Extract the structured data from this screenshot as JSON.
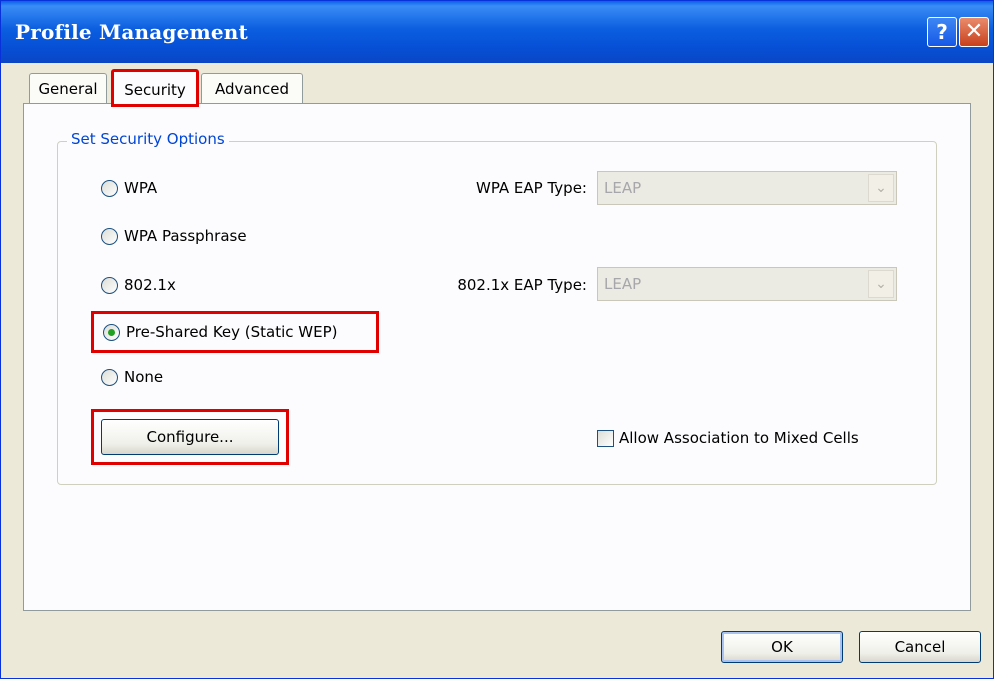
{
  "window": {
    "title": "Profile Management",
    "help_label": "?",
    "close_label": "✕"
  },
  "tabs": {
    "general": "General",
    "security": "Security",
    "advanced": "Advanced"
  },
  "security": {
    "group_label": "Set Security Options",
    "options": {
      "wpa": "WPA",
      "wpa_passphrase": "WPA Passphrase",
      "dot1x": "802.1x",
      "psk": "Pre-Shared Key (Static WEP)",
      "none": "None"
    },
    "selected_option": "Pre-Shared Key (Static WEP)",
    "wpa_eap_label": "WPA EAP Type:",
    "wpa_eap_value": "LEAP",
    "dot1x_eap_label": "802.1x EAP Type:",
    "dot1x_eap_value": "LEAP",
    "configure_label": "Configure...",
    "mixed_cells_label": "Allow Association to Mixed Cells",
    "mixed_cells_checked": false
  },
  "footer": {
    "ok_label": "OK",
    "cancel_label": "Cancel"
  },
  "colors": {
    "highlight": "#e00000",
    "title_bar": "#0a5fe8",
    "group_label": "#0046d5"
  }
}
